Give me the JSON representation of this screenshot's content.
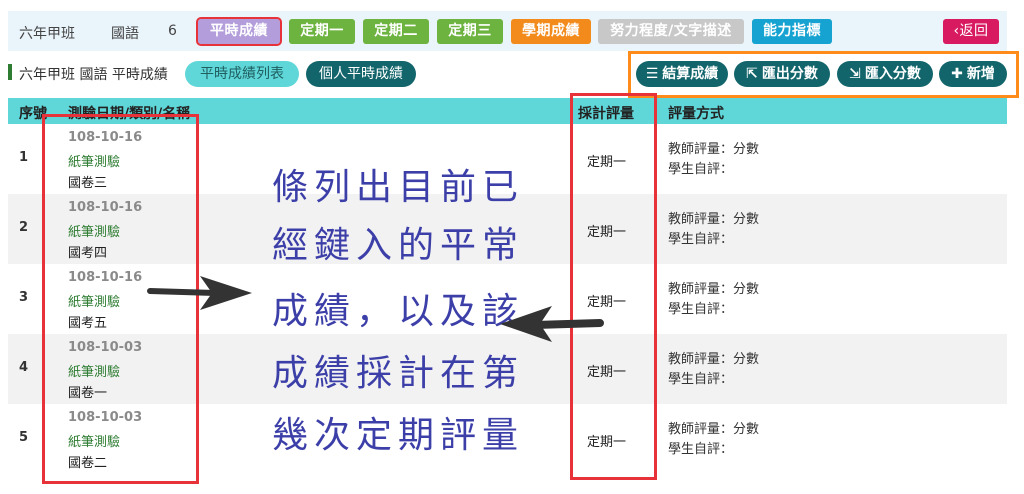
{
  "topbar": {
    "class_name": "六年甲班",
    "subject": "國語",
    "count": "6",
    "tabs": [
      {
        "label": "平時成績",
        "color": "#b39ddb"
      },
      {
        "label": "定期一",
        "color": "#6db33f"
      },
      {
        "label": "定期二",
        "color": "#6db33f"
      },
      {
        "label": "定期三",
        "color": "#6db33f"
      },
      {
        "label": "學期成績",
        "color": "#f38b1c"
      },
      {
        "label": "努力程度/文字描述",
        "color": "#c8c8c8"
      },
      {
        "label": "能力指標",
        "color": "#17a3d1"
      }
    ],
    "back_label": "返回",
    "back_color": "#d81b60"
  },
  "subheader": {
    "breadcrumb": "六年甲班 國語 平時成績",
    "pill_list": "平時成績列表",
    "pill_personal": "個人平時成績"
  },
  "actions": {
    "calc": "結算成績",
    "export": "匯出分數",
    "import": "匯入分數",
    "add": "新增"
  },
  "table": {
    "headers": {
      "idx": "序號",
      "test": "測驗日期/類別/名稱",
      "term": "採計評量",
      "method": "評量方式"
    },
    "rows": [
      {
        "idx": "1",
        "date": "108-10-16",
        "type": "紙筆測驗",
        "name": "國卷三",
        "term": "定期一",
        "teacher": "教師評量：分數",
        "self": "學生自評："
      },
      {
        "idx": "2",
        "date": "108-10-16",
        "type": "紙筆測驗",
        "name": "國考四",
        "term": "定期一",
        "teacher": "教師評量：分數",
        "self": "學生自評："
      },
      {
        "idx": "3",
        "date": "108-10-16",
        "type": "紙筆測驗",
        "name": "國考五",
        "term": "定期一",
        "teacher": "教師評量：分數",
        "self": "學生自評："
      },
      {
        "idx": "4",
        "date": "108-10-03",
        "type": "紙筆測驗",
        "name": "國卷一",
        "term": "定期一",
        "teacher": "教師評量：分數",
        "self": "學生自評："
      },
      {
        "idx": "5",
        "date": "108-10-03",
        "type": "紙筆測驗",
        "name": "國卷二",
        "term": "定期一",
        "teacher": "教師評量：分數",
        "self": "學生自評："
      }
    ]
  },
  "annotation": {
    "lines": [
      "條列出目前已",
      "經鍵入的平常",
      "成績，以及該",
      "成績採計在第",
      "幾次定期評量"
    ]
  },
  "icons": {
    "calc": "list-icon",
    "export": "export-icon",
    "import": "import-icon",
    "add": "plus-icon",
    "back": "chevron-left-icon"
  }
}
